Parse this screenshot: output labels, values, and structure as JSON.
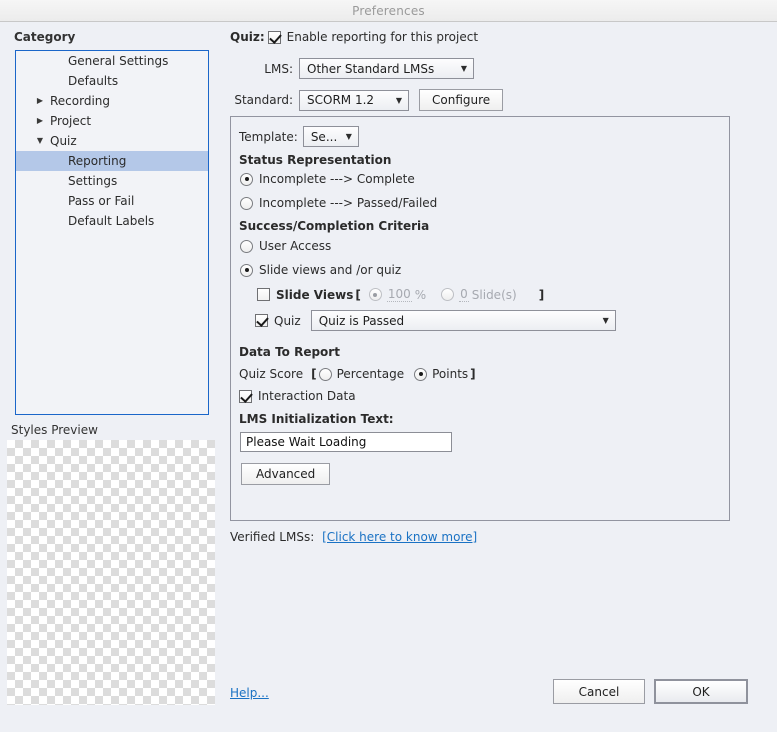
{
  "window": {
    "title": "Preferences"
  },
  "sidebar": {
    "heading": "Category",
    "items": [
      {
        "label": "General Settings",
        "level": "child",
        "twisty": "none",
        "selected": false
      },
      {
        "label": "Defaults",
        "level": "child",
        "twisty": "none",
        "selected": false
      },
      {
        "label": "Recording",
        "level": "parent",
        "twisty": "collapsed",
        "selected": false
      },
      {
        "label": "Project",
        "level": "parent",
        "twisty": "collapsed",
        "selected": false
      },
      {
        "label": "Quiz",
        "level": "parent",
        "twisty": "expanded",
        "selected": false
      },
      {
        "label": "Reporting",
        "level": "child",
        "twisty": "none",
        "selected": true
      },
      {
        "label": "Settings",
        "level": "child",
        "twisty": "none",
        "selected": false
      },
      {
        "label": "Pass or Fail",
        "level": "child",
        "twisty": "none",
        "selected": false
      },
      {
        "label": "Default Labels",
        "level": "child",
        "twisty": "none",
        "selected": false
      }
    ],
    "styles_preview_label": "Styles Preview"
  },
  "main": {
    "quiz_prefix": "Quiz:",
    "enable_reporting_label": "Enable reporting for this project",
    "enable_reporting_checked": true,
    "lms_label": "LMS:",
    "lms_value": "Other Standard LMSs",
    "standard_label": "Standard:",
    "standard_value": "SCORM 1.2",
    "configure_label": "Configure",
    "template_label": "Template:",
    "template_value": "Se...",
    "status_representation": {
      "heading": "Status Representation",
      "option_complete": "Incomplete ---> Complete",
      "option_passfail": "Incomplete ---> Passed/Failed",
      "selected": "option_complete"
    },
    "success_criteria": {
      "heading": "Success/Completion Criteria",
      "option_user_access": "User Access",
      "option_slide_views_quiz": "Slide views and /or quiz",
      "selected": "option_slide_views_quiz",
      "slide_views_label": "Slide Views",
      "slide_views_checked": false,
      "bracket_open": "[",
      "bracket_close": "]",
      "percent_value": "100",
      "percent_unit": "%",
      "slides_value": "0",
      "slides_unit": "Slide(s)",
      "sub_selected": "percent",
      "quiz_label": "Quiz",
      "quiz_checked": true,
      "quiz_condition_value": "Quiz is Passed"
    },
    "data_to_report": {
      "heading": "Data To Report",
      "quiz_score_label": "Quiz Score",
      "bracket_open": "[",
      "bracket_close": "]",
      "option_percentage": "Percentage",
      "option_points": "Points",
      "selected": "option_points",
      "interaction_data_label": "Interaction Data",
      "interaction_data_checked": true,
      "lms_init_label": "LMS Initialization Text:",
      "lms_init_value": "Please Wait Loading",
      "advanced_label": "Advanced"
    },
    "verified_lms_label": "Verified LMSs:",
    "verified_lms_link": "[Click here to know more]"
  },
  "footer": {
    "help_label": "Help...",
    "cancel_label": "Cancel",
    "ok_label": "OK"
  },
  "colors": {
    "window_bg": "#eef0f5",
    "selection": "#b4c8e8",
    "focus_border": "#1b66c9",
    "link": "#1a72c4"
  }
}
